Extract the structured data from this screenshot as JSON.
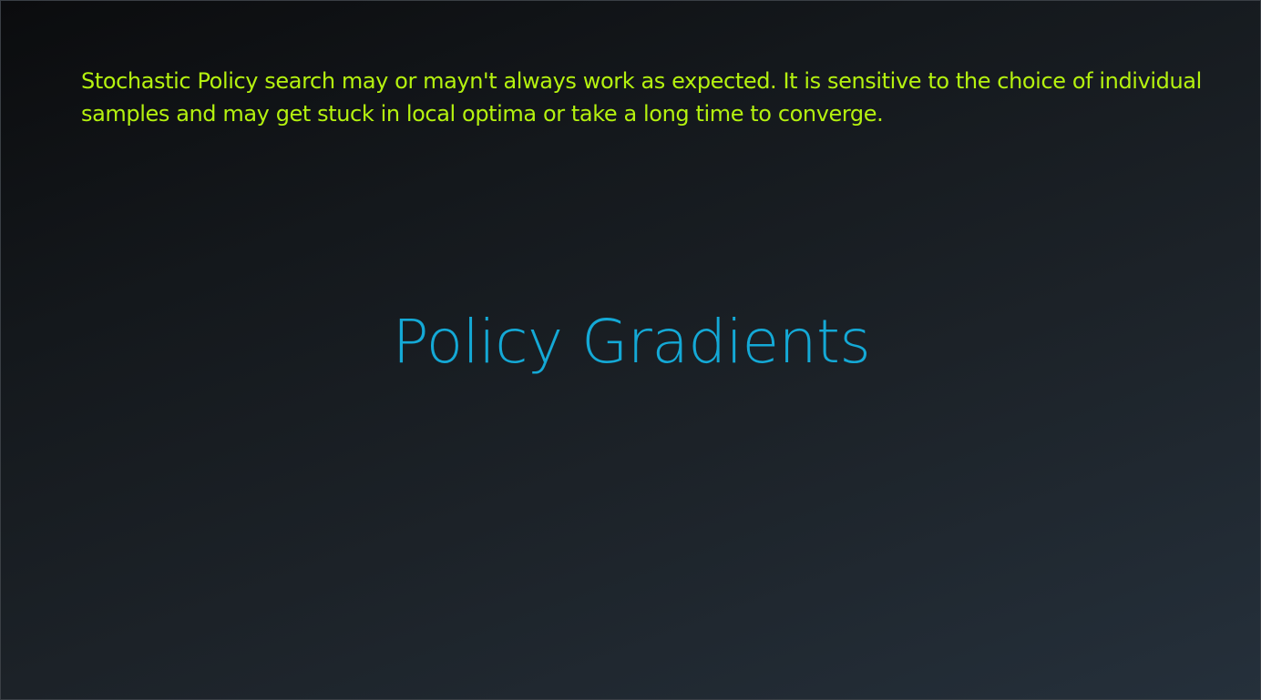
{
  "slide": {
    "note_text": "Stochastic Policy search may or mayn't always work as expected. It is sensitive to the choice of individual samples and may get stuck in local optima or take a long time to converge.",
    "title": "Policy Gradients"
  },
  "colors": {
    "note": "#b5f20f",
    "title": "#14a9d6",
    "background_dark": "#0b0c0e",
    "background_light": "#25303b"
  }
}
